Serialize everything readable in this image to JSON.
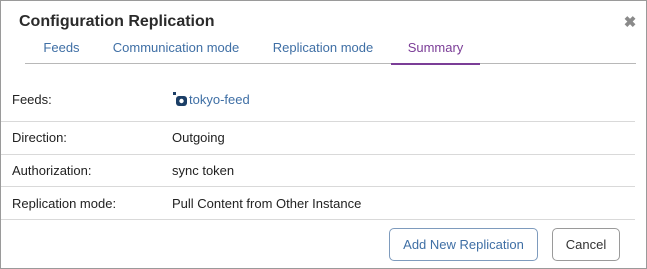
{
  "dialog": {
    "title": "Configuration Replication",
    "close_glyph": "✖"
  },
  "tabs": [
    {
      "label": "Feeds",
      "active": false
    },
    {
      "label": "Communication mode",
      "active": false
    },
    {
      "label": "Replication mode",
      "active": false
    },
    {
      "label": "Summary",
      "active": true
    }
  ],
  "summary": {
    "feeds_label": "Feeds:",
    "feeds_value": "tokyo-feed",
    "feeds_icon": "feed-icon",
    "direction_label": "Direction:",
    "direction_value": "Outgoing",
    "authorization_label": "Authorization:",
    "authorization_value": "sync token",
    "replication_mode_label": "Replication mode:",
    "replication_mode_value": "Pull Content from Other Instance"
  },
  "buttons": {
    "add_label": "Add New Replication",
    "cancel_label": "Cancel"
  },
  "colors": {
    "link": "#3f6fa5",
    "active_tab": "#7b3d97"
  }
}
